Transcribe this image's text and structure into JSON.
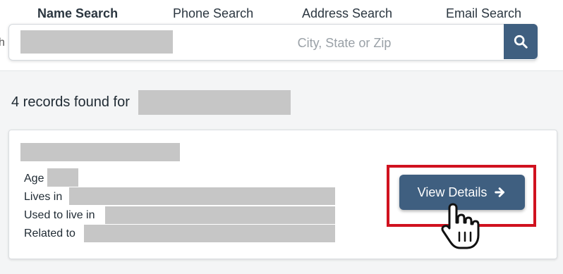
{
  "tabs": [
    {
      "label": "Name Search",
      "active": true
    },
    {
      "label": "Phone Search",
      "active": false
    },
    {
      "label": "Address Search",
      "active": false
    },
    {
      "label": "Email Search",
      "active": false
    }
  ],
  "search": {
    "location_placeholder": "City, State or Zip",
    "button_icon": "search-icon",
    "edge_letter": "h"
  },
  "results": {
    "count_text": "4 records found for"
  },
  "record": {
    "age_label": "Age",
    "lives_label": "Lives in",
    "used_label": "Used to live in",
    "related_label": "Related to",
    "button_label": "View Details",
    "button_icon": "arrow-right-icon"
  },
  "colors": {
    "accent": "#3f5f80",
    "highlight": "#d0121f",
    "redaction": "#c6c6c6"
  },
  "cursor_icon": "hand-pointer-icon"
}
